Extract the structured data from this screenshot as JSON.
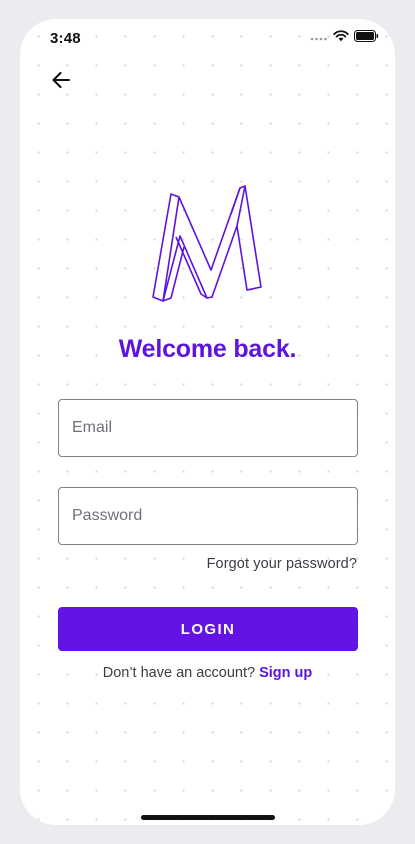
{
  "status_bar": {
    "time": "3:48",
    "icons": [
      "signal-dots-icon",
      "wifi-icon",
      "battery-icon"
    ]
  },
  "header": {
    "back_icon": "arrow-left-icon"
  },
  "logo": {
    "icon": "m-logo-icon",
    "color": "#5e14dc"
  },
  "title": "Welcome back.",
  "form": {
    "email_placeholder": "Email",
    "password_placeholder": "Password",
    "forgot_label": "Forgot your password?",
    "login_label": "LOGIN"
  },
  "signup": {
    "prompt": "Don’t have an account?",
    "link_label": "Sign up"
  },
  "colors": {
    "accent": "#6512e6",
    "title": "#5e14dc",
    "background": "#ffffff"
  }
}
